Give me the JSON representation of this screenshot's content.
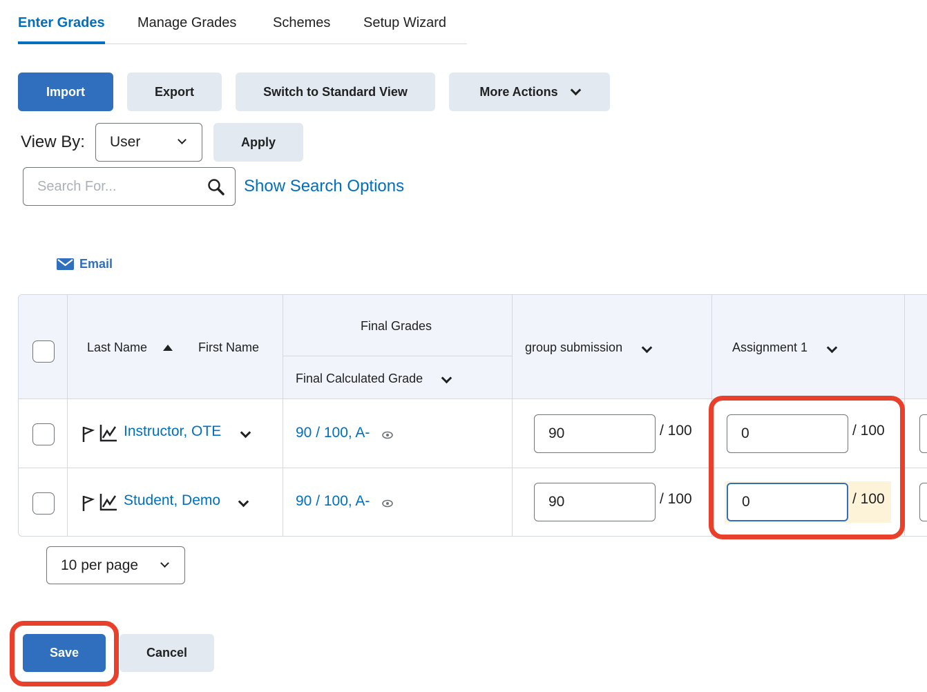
{
  "tabs": [
    {
      "label": "Enter Grades",
      "active": true
    },
    {
      "label": "Manage Grades"
    },
    {
      "label": "Schemes"
    },
    {
      "label": "Setup Wizard"
    }
  ],
  "toolbar": {
    "import": "Import",
    "export": "Export",
    "switch_view": "Switch to Standard View",
    "more_actions": "More Actions"
  },
  "view_by": {
    "label": "View By:",
    "selected": "User",
    "apply": "Apply"
  },
  "search": {
    "placeholder": "Search For...",
    "options_link": "Show Search Options"
  },
  "email_link": "Email",
  "table": {
    "headers": {
      "last_name": "Last Name",
      "first_name": "First Name",
      "final_grades": "Final Grades",
      "final_calculated": "Final Calculated Grade",
      "group_submission": "group submission",
      "assignment1": "Assignment 1"
    },
    "rows": [
      {
        "name": "Instructor, OTE",
        "final_grade": "90 / 100, A-",
        "group_submission": "90",
        "group_out_of": "/ 100",
        "assignment1": "0",
        "assignment1_out_of": "/ 100"
      },
      {
        "name": "Student, Demo",
        "final_grade": "90 / 100, A-",
        "group_submission": "90",
        "group_out_of": "/ 100",
        "assignment1": "0",
        "assignment1_out_of": "/ 100"
      }
    ]
  },
  "pagination": {
    "per_page": "10 per page"
  },
  "footer": {
    "save": "Save",
    "cancel": "Cancel"
  },
  "colors": {
    "accent": "#2f6fbd",
    "link": "#006fbf",
    "highlight": "#e8402a",
    "changed": "#fdf3d8"
  }
}
